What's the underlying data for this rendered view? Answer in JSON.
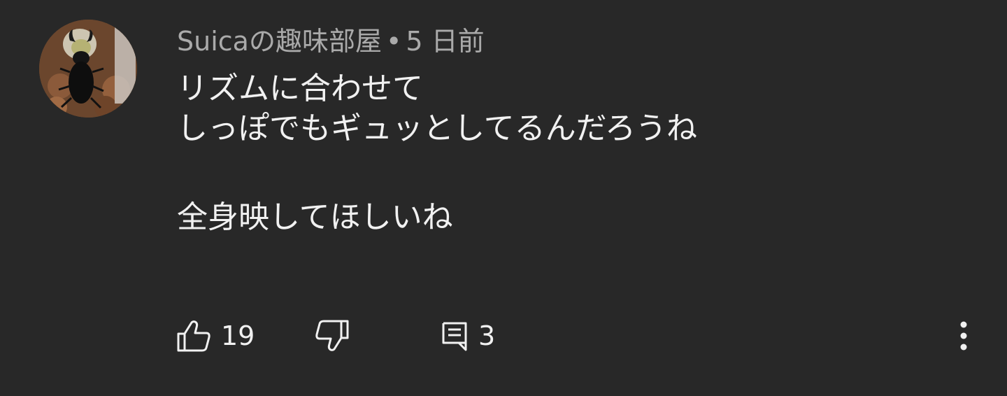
{
  "comment": {
    "author": "Suicaの趣味部屋",
    "separator": "•",
    "time": "5 日前",
    "text_lines": [
      "リズムに合わせて",
      "しっぽでもギュッとしてるんだろうね",
      "",
      "全身映してほしいね"
    ],
    "likes": "19",
    "replies": "3"
  },
  "icons": {
    "avatar": "stag-beetle-avatar",
    "like": "thumbs-up-icon",
    "dislike": "thumbs-down-icon",
    "reply": "comment-icon",
    "more": "more-vertical-icon"
  },
  "colors": {
    "background": "#282828",
    "text_primary": "#f1f1f1",
    "text_secondary": "#aaaaaa"
  }
}
